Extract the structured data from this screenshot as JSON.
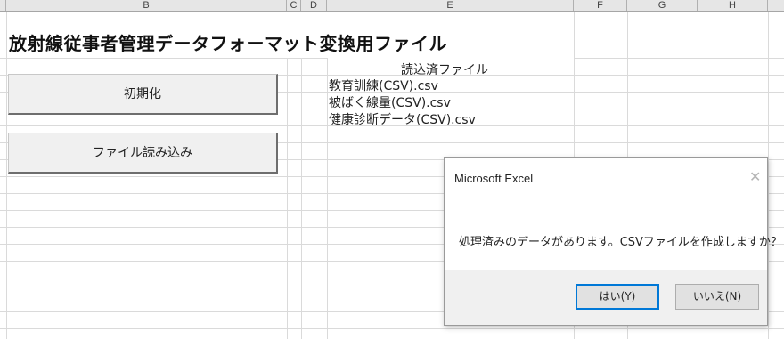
{
  "sheet": {
    "columns": [
      "B",
      "C",
      "D",
      "E",
      "F",
      "G",
      "H"
    ],
    "title": "放射線従事者管理データフォーマット変換用ファイル",
    "buttons": {
      "init": "初期化",
      "load": "ファイル読み込み"
    },
    "files_header": "読込済ファイル",
    "files": [
      "教育訓練(CSV).csv",
      "被ばく線量(CSV).csv",
      "健康診断データ(CSV).csv"
    ]
  },
  "dialog": {
    "title": "Microsoft Excel",
    "close_icon": "close-icon",
    "message": "処理済みのデータがあります。CSVファイルを作成しますか？",
    "yes_label": "はい(Y)",
    "no_label": "いいえ(N)"
  }
}
